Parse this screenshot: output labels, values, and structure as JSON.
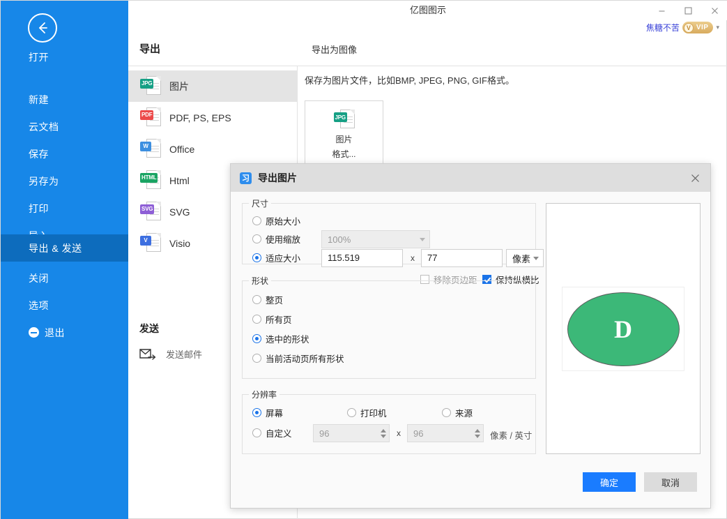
{
  "window": {
    "title": "亿图图示",
    "minimize": "−",
    "maximize": "□",
    "close": "✕"
  },
  "account": {
    "user_name": "焦糖不苦",
    "vip_label": "VIP",
    "vip_icon_letter": "V",
    "caret": "▾"
  },
  "sidebar": {
    "back_icon": "back-arrow-icon",
    "items": [
      {
        "label": "打开",
        "active": false
      },
      {
        "label": "新建",
        "active": false
      },
      {
        "label": "云文档",
        "active": false
      },
      {
        "label": "保存",
        "active": false
      },
      {
        "label": "另存为",
        "active": false
      },
      {
        "label": "打印",
        "active": false
      },
      {
        "label": "导入",
        "active": false
      },
      {
        "label": "导出 & 发送",
        "active": true
      },
      {
        "label": "关闭",
        "active": false
      },
      {
        "label": "选项",
        "active": false
      }
    ],
    "exit_label": "退出"
  },
  "export": {
    "heading": "导出",
    "formats": [
      {
        "label": "图片",
        "tag": "JPG",
        "color": "#16a085",
        "selected": true
      },
      {
        "label": "PDF, PS, EPS",
        "tag": "PDF",
        "color": "#ec4a4a",
        "selected": false
      },
      {
        "label": "Office",
        "tag": "W",
        "color": "#3d8fe0",
        "selected": false
      },
      {
        "label": "Html",
        "tag": "HTML",
        "color": "#1aa463",
        "selected": false
      },
      {
        "label": "SVG",
        "tag": "SVG",
        "color": "#8e5fd6",
        "selected": false
      },
      {
        "label": "Visio",
        "tag": "V",
        "color": "#3d6fe0",
        "selected": false
      }
    ],
    "send_heading": "发送",
    "send_mail_label": "发送邮件"
  },
  "main": {
    "heading": "导出为图像",
    "description": "保存为图片文件，比如BMP, JPEG, PNG, GIF格式。",
    "card": {
      "tag": "JPG",
      "color": "#16a085",
      "line1": "图片",
      "line2": "格式..."
    }
  },
  "dialog": {
    "title": "导出图片",
    "app_icon_letter": "习",
    "close": "✕",
    "size": {
      "legend": "尺寸",
      "option_original": "原始大小",
      "option_scale": "使用缩放",
      "option_fit": "适应大小",
      "selected": "适应大小",
      "scale_value": "100%",
      "width_value": "115.519",
      "height_value": "77",
      "separator": "x",
      "unit_value": "像素",
      "remove_margin_label": "移除页边距",
      "remove_margin_checked": false,
      "keep_ratio_label": "保持纵横比",
      "keep_ratio_checked": true
    },
    "shape": {
      "legend": "形状",
      "options": [
        "整页",
        "所有页",
        "选中的形状",
        "当前活动页所有形状"
      ],
      "selected": "选中的形状"
    },
    "resolution": {
      "legend": "分辨率",
      "options": [
        "屏幕",
        "打印机",
        "来源",
        "自定义"
      ],
      "selected": "屏幕",
      "dpi_x": "96",
      "dpi_y": "96",
      "separator": "x",
      "unit_suffix": "像素 / 英寸"
    },
    "preview": {
      "shape_letter": "D",
      "shape_color": "#3cb878"
    },
    "buttons": {
      "ok": "确定",
      "cancel": "取消"
    }
  },
  "colors": {
    "sidebar_blue": "#1787e8",
    "sidebar_active_blue": "#0d6cbd",
    "accent_blue": "#1a7cff",
    "radio_blue": "#1a73e8",
    "preview_green": "#3cb878"
  }
}
